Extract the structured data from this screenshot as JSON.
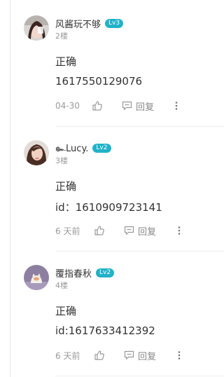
{
  "comments": [
    {
      "username": "风酱玩不够",
      "level": "Lv3",
      "floor": "2楼",
      "lines": [
        "正确",
        "1617550129076"
      ],
      "time": "04-30",
      "reply_label": "回复"
    },
    {
      "username": "๛Lucy.",
      "level": "Lv2",
      "floor": "3楼",
      "lines": [
        "正确",
        "id：1610909723141"
      ],
      "time": "6 天前",
      "reply_label": "回复"
    },
    {
      "username": "覆指春秋",
      "level": "Lv2",
      "floor": "4楼",
      "lines": [
        "正确",
        "id:1617633412392"
      ],
      "time": "6 天前",
      "reply_label": "回复"
    }
  ],
  "colors": {
    "badge": "#21b2c8",
    "muted": "#999999",
    "text": "#333333"
  },
  "icons": [
    "thumbs-up-icon",
    "reply-bubble-icon",
    "more-vertical-icon"
  ]
}
